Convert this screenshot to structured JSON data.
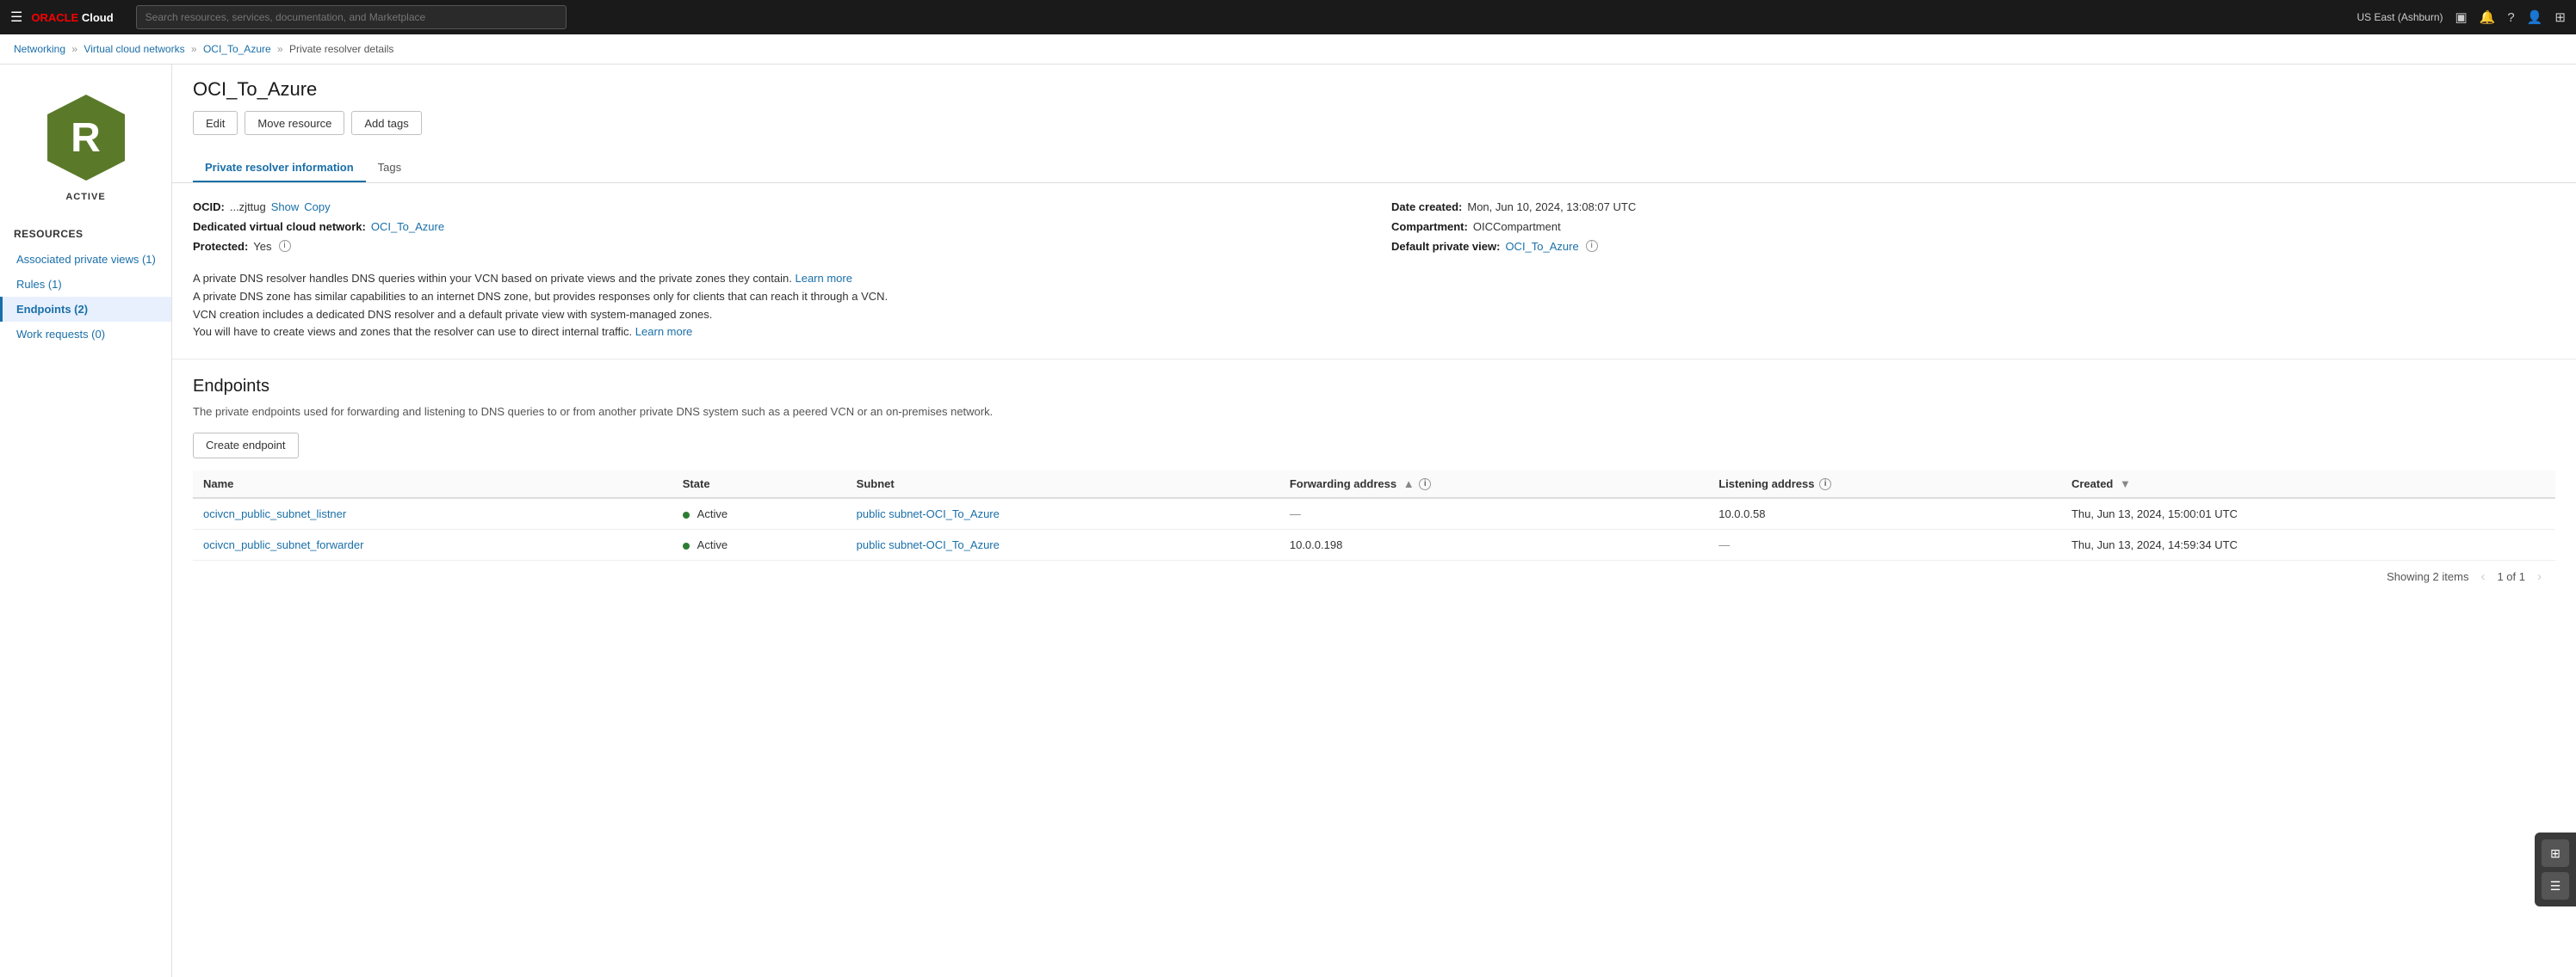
{
  "nav": {
    "logo_oracle": "Oracle",
    "logo_cloud": "Cloud",
    "search_placeholder": "Search resources, services, documentation, and Marketplace",
    "region": "US East (Ashburn)",
    "icons": {
      "monitor": "▣",
      "bell": "🔔",
      "question": "?",
      "person": "👤",
      "grid": "⊞"
    }
  },
  "breadcrumb": {
    "items": [
      {
        "label": "Networking",
        "href": true
      },
      {
        "label": "Virtual cloud networks",
        "href": true
      },
      {
        "label": "OCI_To_Azure",
        "href": true
      },
      {
        "label": "Private resolver details",
        "href": false
      }
    ],
    "separators": [
      "»",
      "»",
      "»"
    ]
  },
  "sidebar": {
    "icon_letter": "R",
    "status": "ACTIVE",
    "resources_label": "Resources",
    "nav_items": [
      {
        "label": "Associated private views (1)",
        "active": false,
        "id": "associated-private-views"
      },
      {
        "label": "Rules (1)",
        "active": false,
        "id": "rules"
      },
      {
        "label": "Endpoints (2)",
        "active": true,
        "id": "endpoints"
      },
      {
        "label": "Work requests (0)",
        "active": false,
        "id": "work-requests"
      }
    ]
  },
  "content": {
    "title": "OCI_To_Azure",
    "buttons": {
      "edit": "Edit",
      "move_resource": "Move resource",
      "add_tags": "Add tags"
    },
    "tabs": [
      {
        "label": "Private resolver information",
        "active": true
      },
      {
        "label": "Tags",
        "active": false
      }
    ],
    "info": {
      "ocid_label": "OCID:",
      "ocid_value": "...zjttug",
      "show_label": "Show",
      "copy_label": "Copy",
      "dedicated_vcn_label": "Dedicated virtual cloud network:",
      "dedicated_vcn_value": "OCI_To_Azure",
      "protected_label": "Protected:",
      "protected_value": "Yes",
      "date_created_label": "Date created:",
      "date_created_value": "Mon, Jun 10, 2024, 13:08:07 UTC",
      "compartment_label": "Compartment:",
      "compartment_value": "OICCompartment",
      "default_private_view_label": "Default private view:",
      "default_private_view_value": "OCI_To_Azure",
      "desc1": "A private DNS resolver handles DNS queries within your VCN based on private views and the private zones they contain.",
      "learn_more1": "Learn more",
      "desc2": "A private DNS zone has similar capabilities to an internet DNS zone, but provides responses only for clients that can reach it through a VCN.",
      "desc3": "VCN creation includes a dedicated DNS resolver and a default private view with system-managed zones.",
      "desc4": "You will have to create views and zones that the resolver can use to direct internal traffic.",
      "learn_more2": "Learn more"
    },
    "endpoints": {
      "section_title": "Endpoints",
      "section_desc": "The private endpoints used for forwarding and listening to DNS queries to or from another private DNS system such as a peered VCN or an on-premises network.",
      "create_btn": "Create endpoint",
      "table": {
        "columns": [
          {
            "label": "Name",
            "sortable": false
          },
          {
            "label": "State",
            "sortable": false
          },
          {
            "label": "Subnet",
            "sortable": false
          },
          {
            "label": "Forwarding address",
            "sortable": true,
            "sort_dir": "asc",
            "has_info": true
          },
          {
            "label": "Listening address",
            "sortable": false,
            "has_info": true
          },
          {
            "label": "Created",
            "sortable": false,
            "has_chevron": true
          }
        ],
        "rows": [
          {
            "name": "ocivcn_public_subnet_listner",
            "state": "Active",
            "subnet": "public subnet-OCI_To_Azure",
            "forwarding_address": "—",
            "listening_address": "10.0.0.58",
            "created": "Thu, Jun 13, 2024, 15:00:01 UTC"
          },
          {
            "name": "ocivcn_public_subnet_forwarder",
            "state": "Active",
            "subnet": "public subnet-OCI_To_Azure",
            "forwarding_address": "10.0.0.198",
            "listening_address": "—",
            "created": "Thu, Jun 13, 2024, 14:59:34 UTC"
          }
        ],
        "pagination": {
          "showing": "Showing 2 items",
          "page_label": "1 of 1"
        }
      }
    }
  },
  "floating_panel": {
    "buttons": [
      "⊞",
      "☰"
    ]
  }
}
